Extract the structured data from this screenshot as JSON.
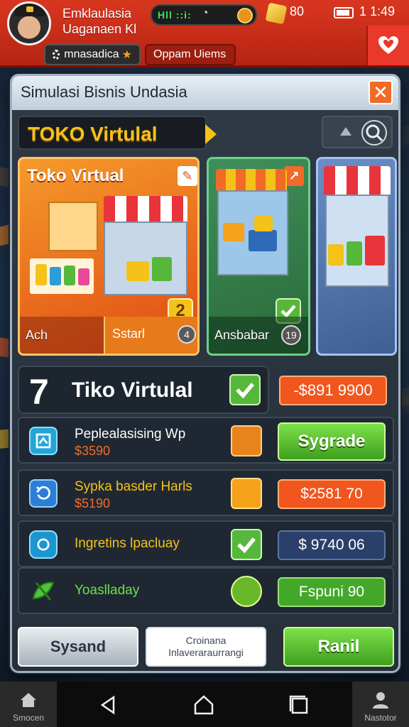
{
  "header": {
    "player_line1": "Emklaulasia",
    "player_line2": "Uaganaen Kl",
    "network_text": "Hll ::i:",
    "status_value": "80",
    "clock": "1 1:49",
    "tab_a_label": "mnasadica",
    "tab_b_label": "Oppam Uiems"
  },
  "panel": {
    "title": "Simulasi Bisnis Undasia",
    "close_label": "✕",
    "store_badge": "TOKO Virtulal"
  },
  "cards": [
    {
      "title": "Toko Virtual",
      "foot_label": "Ach",
      "sub_label": "Sstarl",
      "badge": "4",
      "number": "2"
    },
    {
      "foot_label": "Ansbabar",
      "badge": "19"
    },
    {}
  ],
  "selected": {
    "number": "7",
    "name": "Tiko Virtulal",
    "price": "-$891 9900"
  },
  "items": [
    {
      "name": "Peplealasising Wp",
      "price": "$3590",
      "button": "Sygrade"
    },
    {
      "name": "Sypka basder Harls",
      "price": "$5190",
      "button": "$2581 70"
    },
    {
      "name": "Ingretins lpacluay",
      "button": "$ 9740 06"
    },
    {
      "name": "Yoaslladay",
      "button": "Fspuni 90"
    }
  ],
  "bottom": {
    "b1": "Sysand",
    "b2_line1": "Croinana",
    "b2_line2": "Inlaveraraurrangi",
    "b3": "Ranil"
  },
  "navbar": {
    "left_label": "Smocen",
    "right_label": "Nastotor"
  },
  "colors": {
    "header_red": "#d8371f",
    "accent_yellow": "#f5c21a",
    "upgrade_green": "#3fa01e",
    "price_orange": "#f0561e"
  }
}
